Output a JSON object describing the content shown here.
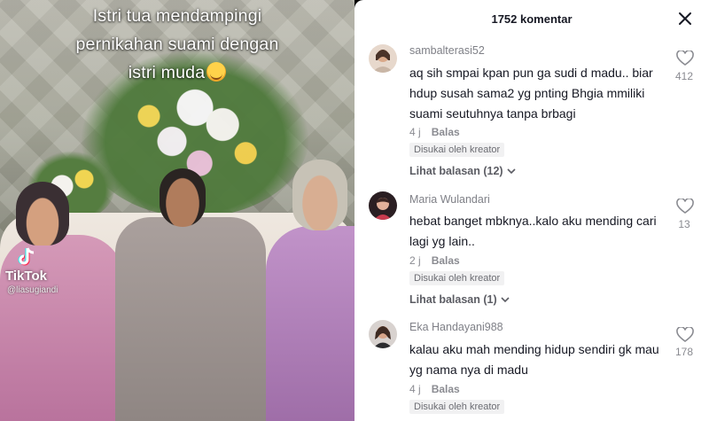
{
  "video": {
    "caption_lines": [
      "Istri tua mendampingi",
      "pernikahan suami dengan",
      "istri muda"
    ],
    "caption_emoji": "smiling-face-with-hearts-emoji",
    "watermark": {
      "brand": "TikTok",
      "handle": "@liasugiandi"
    }
  },
  "panel": {
    "title": "1752 komentar",
    "close_icon": "close-icon"
  },
  "comments": [
    {
      "username": "sambalterasi52",
      "text": "aq sih smpai kpan pun ga sudi d madu.. biar hdup susah sama2 yg pnting Bhgia mmiliki suami seutuhnya tanpa brbagi",
      "time": "4 j",
      "reply_label": "Balas",
      "creator_badge": "Disukai oleh kreator",
      "view_replies": "Lihat balasan (12)",
      "likes": "412"
    },
    {
      "username": "Maria Wulandari",
      "text": "hebat banget mbknya..kalo aku mending cari lagi yg lain..",
      "time": "2 j",
      "reply_label": "Balas",
      "creator_badge": "Disukai oleh kreator",
      "view_replies": "Lihat balasan (1)",
      "likes": "13"
    },
    {
      "username": "Eka Handayani988",
      "text": "kalau aku mah mending hidup sendiri gk mau yg nama nya di madu",
      "time": "4 j",
      "reply_label": "Balas",
      "creator_badge": "Disukai oleh kreator",
      "likes": "178"
    }
  ]
}
